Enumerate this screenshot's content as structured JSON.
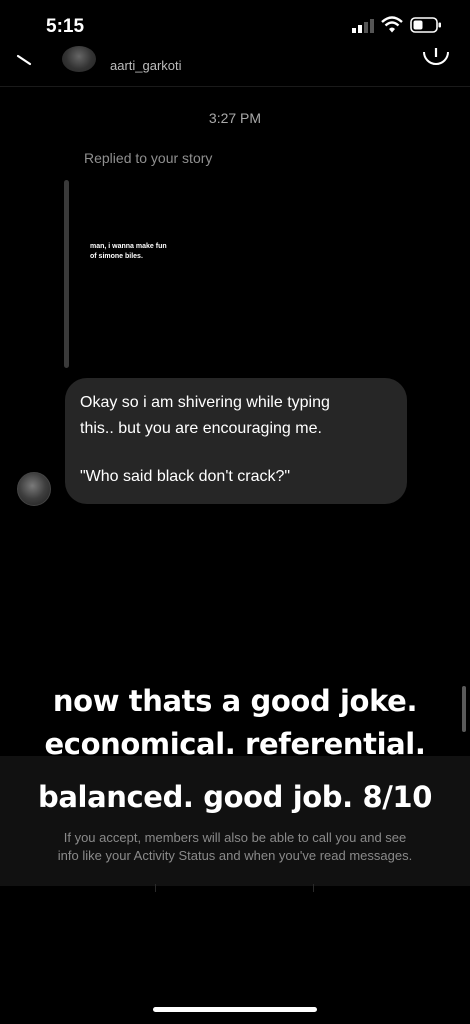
{
  "status_bar": {
    "time": "5:15"
  },
  "header": {
    "username": "aarti_garkoti"
  },
  "thread": {
    "timestamp": "3:27 PM",
    "replied_label": "Replied to your story",
    "story_text_line1": "man, i wanna make fun",
    "story_text_line2": "of simone biles.",
    "message_line1": "Okay so i am shivering while typing",
    "message_line2": "this.. but you are encouraging me.",
    "message_line3": "\"Who said black don't crack?\""
  },
  "caption": {
    "line1": "now thats a good joke.",
    "line2": "economical. referential.",
    "line3": "balanced. good job. 8/10"
  },
  "request": {
    "info_line1": "If you accept, members will also be able to call you and see",
    "info_line2": "info like your Activity Status and when you've read messages."
  },
  "colors": {
    "background": "#000000",
    "bubble": "#262626",
    "muted_text": "#8a8a8a"
  },
  "icons": [
    "signal-icon",
    "wifi-icon",
    "battery-icon",
    "back-chevron-icon",
    "info-icon"
  ]
}
